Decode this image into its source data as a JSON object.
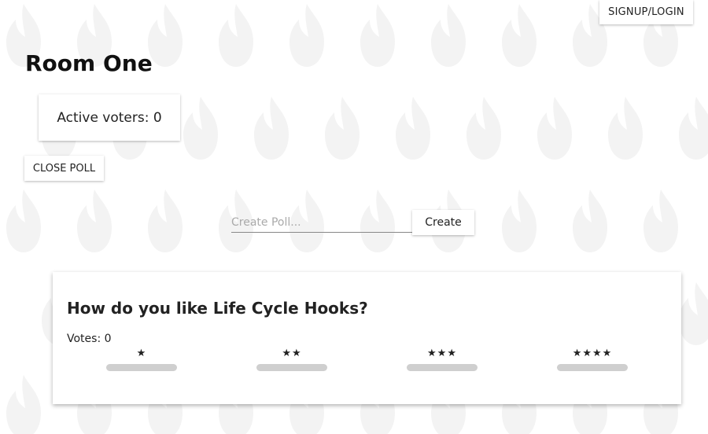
{
  "header": {
    "auth_label": "SIGNUP/LOGIN"
  },
  "room": {
    "title": "Room One",
    "active_voters_text": "Active voters: 0",
    "close_poll_label": "CLOSE POLL"
  },
  "create_poll": {
    "placeholder": "Create Poll...",
    "value": "",
    "button_label": "Create"
  },
  "poll": {
    "question": "How do you like Life Cycle Hooks?",
    "votes_text": "Votes: 0",
    "options": [
      {
        "stars": "★",
        "fraction": 0
      },
      {
        "stars": "★★",
        "fraction": 0
      },
      {
        "stars": "★★★",
        "fraction": 0
      },
      {
        "stars": "★★★★",
        "fraction": 0
      }
    ]
  },
  "colors": {
    "background_flame": "#f3f3f3",
    "bar_track": "#cfcfcf"
  },
  "icons": {
    "background": "flame-icon",
    "rating": "star-icon"
  }
}
